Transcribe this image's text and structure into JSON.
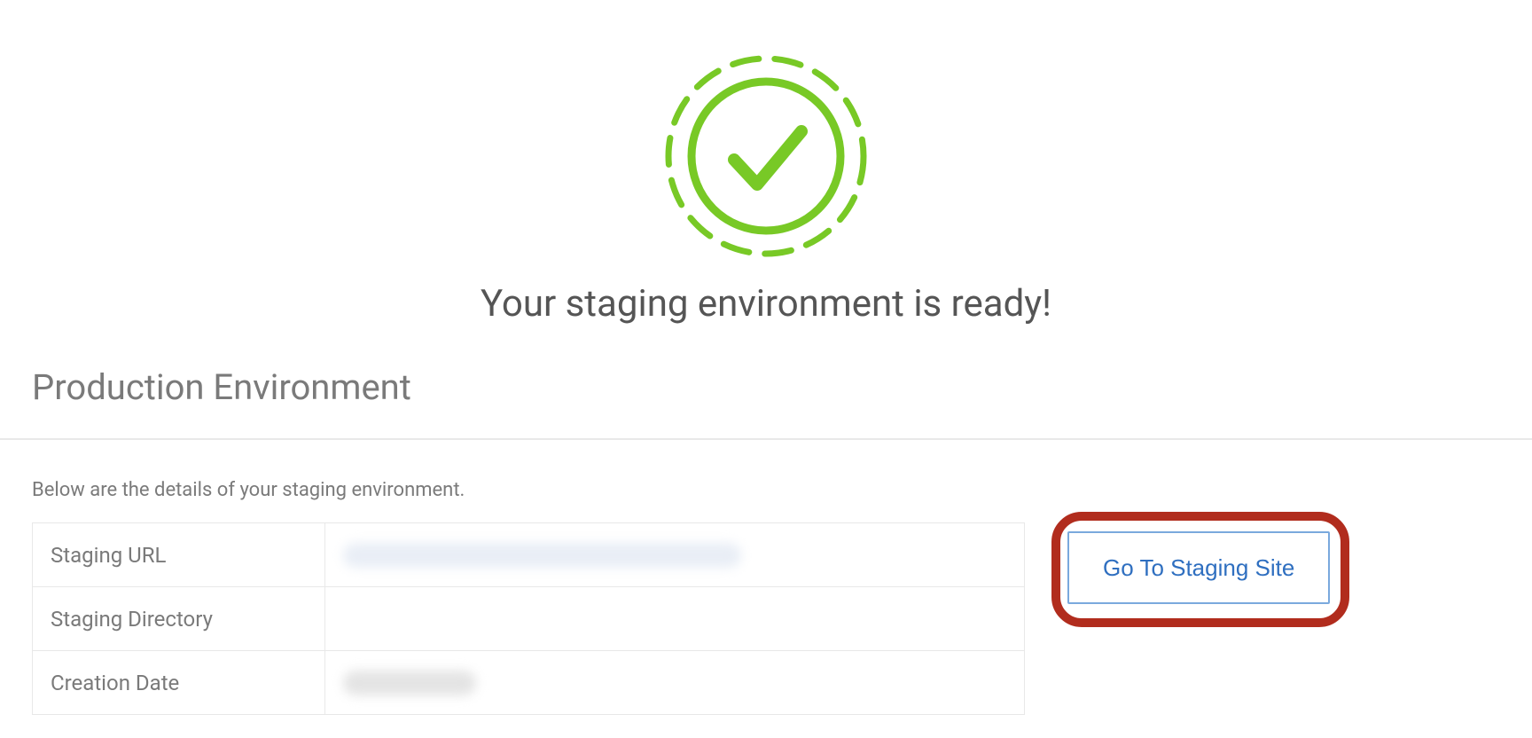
{
  "success": {
    "heading": "Your staging environment is ready!",
    "icon_color": "#78c926"
  },
  "section": {
    "title": "Production Environment",
    "details_intro": "Below are the details of your staging environment."
  },
  "table": {
    "rows": [
      {
        "label": "Staging URL",
        "value": ""
      },
      {
        "label": "Staging Directory",
        "value": ""
      },
      {
        "label": "Creation Date",
        "value": ""
      }
    ]
  },
  "actions": {
    "go_to_staging_label": "Go To Staging Site"
  }
}
